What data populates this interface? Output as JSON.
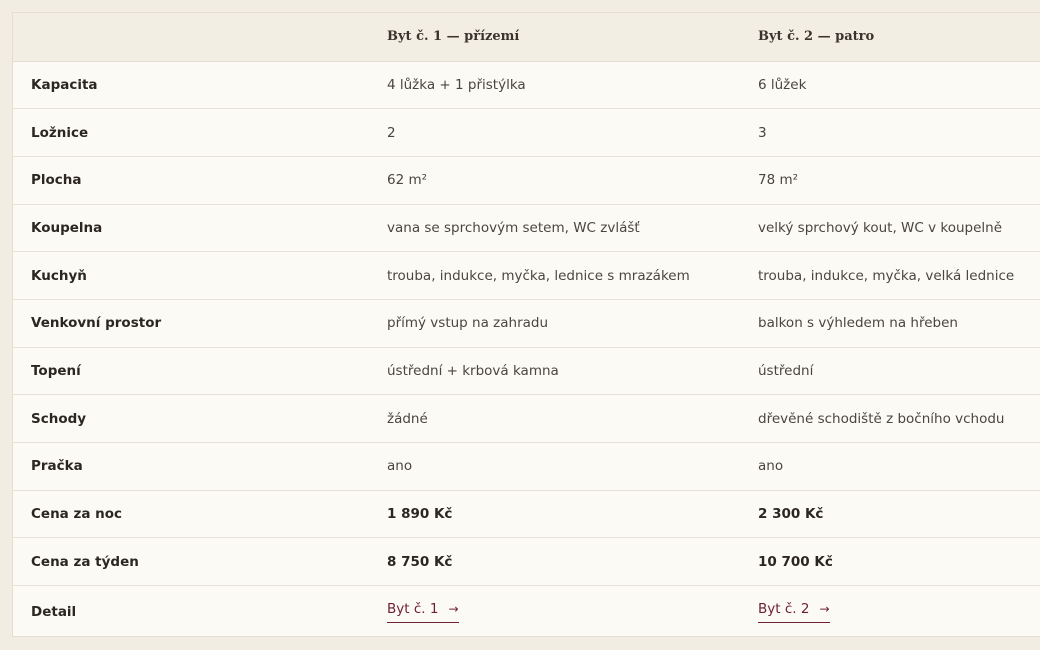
{
  "header": {
    "col0": "",
    "col1": "Byt č. 1 — přízemí",
    "col2": "Byt č. 2 — patro"
  },
  "rows": [
    {
      "label": "Kapacita",
      "a": "4 lůžka + 1 přistýlka",
      "b": "6 lůžek"
    },
    {
      "label": "Ložnice",
      "a": "2",
      "b": "3"
    },
    {
      "label": "Plocha",
      "a": "62 m²",
      "b": "78 m²"
    },
    {
      "label": "Koupelna",
      "a": "vana se sprchovým setem, WC zvlášť",
      "b": "velký sprchový kout, WC v koupelně"
    },
    {
      "label": "Kuchyň",
      "a": "trouba, indukce, myčka, lednice s mrazákem",
      "b": "trouba, indukce, myčka, velká lednice"
    },
    {
      "label": "Venkovní prostor",
      "a": "přímý vstup na zahradu",
      "b": "balkon s výhledem na hřeben"
    },
    {
      "label": "Topení",
      "a": "ústřední + krbová kamna",
      "b": "ústřední"
    },
    {
      "label": "Schody",
      "a": "žádné",
      "b": "dřevěné schodiště z bočního vchodu"
    },
    {
      "label": "Pračka",
      "a": "ano",
      "b": "ano"
    },
    {
      "label": "Cena za noc",
      "a": "1 890 Kč",
      "b": "2 300 Kč"
    },
    {
      "label": "Cena za týden",
      "a": "8 750 Kč",
      "b": "10 700 Kč"
    }
  ],
  "detail": {
    "label": "Detail",
    "link_a": "Byt č. 1",
    "link_b": "Byt č. 2",
    "arrow": "→"
  },
  "colors": {
    "background": "#f2ede3",
    "table_bg": "#fcfaf5",
    "link": "#6e1f33"
  }
}
